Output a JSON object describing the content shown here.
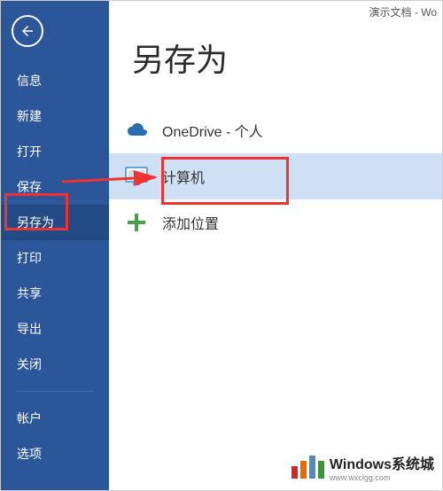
{
  "titlebar": {
    "doc": "演示文档 - Wo"
  },
  "sidebar": {
    "items": [
      {
        "label": "信息"
      },
      {
        "label": "新建"
      },
      {
        "label": "打开"
      },
      {
        "label": "保存"
      },
      {
        "label": "另存为"
      },
      {
        "label": "打印"
      },
      {
        "label": "共享"
      },
      {
        "label": "导出"
      },
      {
        "label": "关闭"
      }
    ],
    "bottom_items": [
      {
        "label": "帐户"
      },
      {
        "label": "选项"
      }
    ]
  },
  "main": {
    "title": "另存为",
    "options": [
      {
        "label": "OneDrive - 个人",
        "icon": "cloud-icon"
      },
      {
        "label": "计算机",
        "icon": "computer-icon"
      },
      {
        "label": "添加位置",
        "icon": "plus-icon"
      }
    ]
  },
  "watermark": {
    "name": "Windows系统城",
    "url": "www.wxclgg.com",
    "bar_colors": [
      "#d22",
      "#e60",
      "#58b",
      "#393"
    ]
  }
}
